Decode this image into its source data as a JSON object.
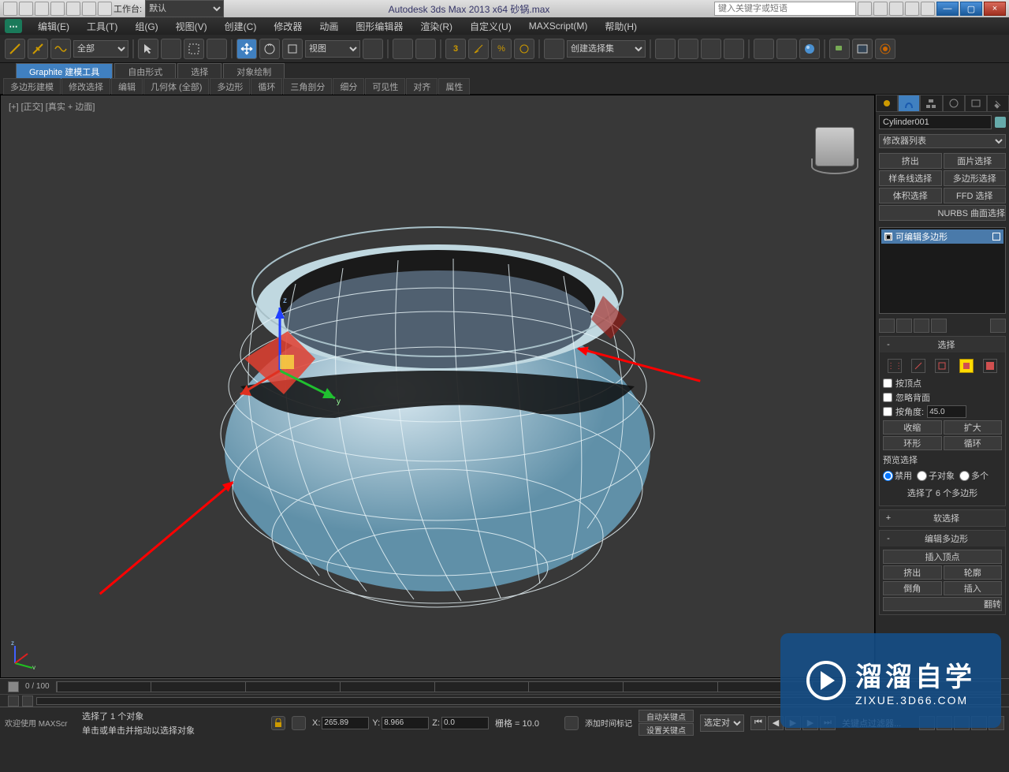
{
  "titlebar": {
    "workspace_label": "工作台:",
    "workspace_value": "默认",
    "center_title": "Autodesk 3ds Max  2013 x64    砂锅.max",
    "search_placeholder": "键入关键字或短语"
  },
  "menu": {
    "items": [
      "编辑(E)",
      "工具(T)",
      "组(G)",
      "视图(V)",
      "创建(C)",
      "修改器",
      "动画",
      "图形编辑器",
      "渲染(R)",
      "自定义(U)",
      "MAXScript(M)",
      "帮助(H)"
    ]
  },
  "toolbar": {
    "select_filter": "全部",
    "ref_coord": "视图",
    "named_sel": "创建选择集"
  },
  "graphite": {
    "tabs": [
      "Graphite 建模工具",
      "自由形式",
      "选择",
      "对象绘制"
    ],
    "ribbon": [
      "多边形建模",
      "修改选择",
      "编辑",
      "几何体 (全部)",
      "多边形",
      "循环",
      "三角剖分",
      "细分",
      "可见性",
      "对齐",
      "属性"
    ]
  },
  "viewport": {
    "label": "[+] [正交] [真实 + 边面]"
  },
  "cmdpanel": {
    "object_name": "Cylinder001",
    "mod_list_placeholder": "修改器列表",
    "mod_buttons": [
      "挤出",
      "面片选择",
      "样条线选择",
      "多边形选择",
      "体积选择",
      "FFD 选择"
    ],
    "nurbs_btn": "NURBS 曲面选择",
    "stack_item": "可编辑多边形",
    "selection": {
      "header": "选择",
      "by_vertex": "按顶点",
      "ignore_back": "忽略背面",
      "by_angle": "按角度:",
      "angle_value": "45.0",
      "shrink": "收缩",
      "grow": "扩大",
      "ring": "环形",
      "loop": "循环",
      "preview_label": "预览选择",
      "radios": [
        "禁用",
        "子对象",
        "多个"
      ],
      "count": "选择了 6 个多边形"
    },
    "soft_sel_header": "软选择",
    "edit_poly_header": "编辑多边形",
    "insert_vertex": "插入顶点",
    "edit_rows": [
      [
        "挤出",
        "轮廓"
      ],
      [
        "倒角",
        "插入"
      ]
    ],
    "flip": "翻转"
  },
  "timeline": {
    "frame_range": "0 / 100"
  },
  "status": {
    "welcome": "欢迎使用  MAXScr",
    "selected": "选择了 1 个对象",
    "prompt": "单击或单击并拖动以选择对象",
    "x": "265.89",
    "y": "8.966",
    "z": "0.0",
    "grid": "栅格 = 10.0",
    "add_time_tag": "添加时间标记",
    "auto_key": "自动关键点",
    "set_key": "设置关键点",
    "sel_list": "选定对",
    "key_filter": "关键点过滤器..."
  },
  "watermark": {
    "t1": "溜溜自学",
    "t2": "ZIXUE.3D66.COM"
  }
}
